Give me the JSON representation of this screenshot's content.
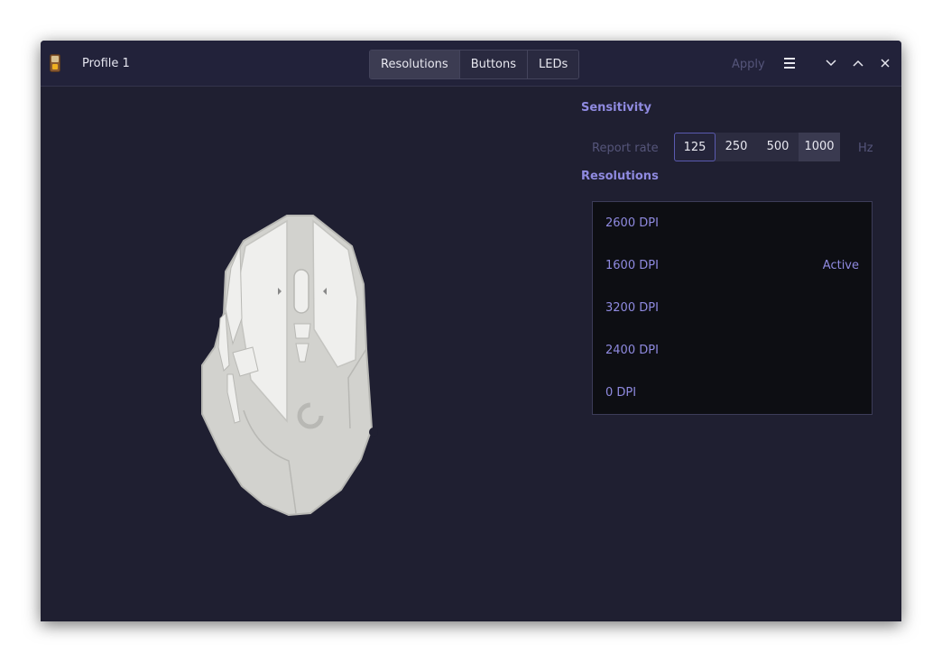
{
  "titlebar": {
    "profile_name": "Profile 1",
    "tabs": [
      {
        "label": "Resolutions",
        "active": true
      },
      {
        "label": "Buttons",
        "active": false
      },
      {
        "label": "LEDs",
        "active": false
      }
    ],
    "apply_label": "Apply"
  },
  "sensitivity": {
    "heading": "Sensitivity",
    "report_rate_label": "Report rate",
    "rates": [
      "125",
      "250",
      "500",
      "1000"
    ],
    "selected_rate": "125",
    "unit": "Hz"
  },
  "resolutions": {
    "heading": "Resolutions",
    "items": [
      {
        "dpi": "2600 DPI",
        "status": ""
      },
      {
        "dpi": "1600 DPI",
        "status": "Active"
      },
      {
        "dpi": "3200 DPI",
        "status": ""
      },
      {
        "dpi": "2400 DPI",
        "status": ""
      },
      {
        "dpi": "0 DPI",
        "status": ""
      }
    ]
  },
  "icons": {
    "app": "mouse-app-icon",
    "menu": "hamburger-menu-icon",
    "minimize": "chevron-down-icon",
    "maximize": "chevron-up-icon",
    "close": "close-icon"
  },
  "colors": {
    "window_bg": "#1f1f31",
    "accent_text": "#8f8ae0",
    "list_bg": "#0d0e13",
    "mouse_body": "#d2d2ce",
    "mouse_buttons": "#efefed"
  }
}
